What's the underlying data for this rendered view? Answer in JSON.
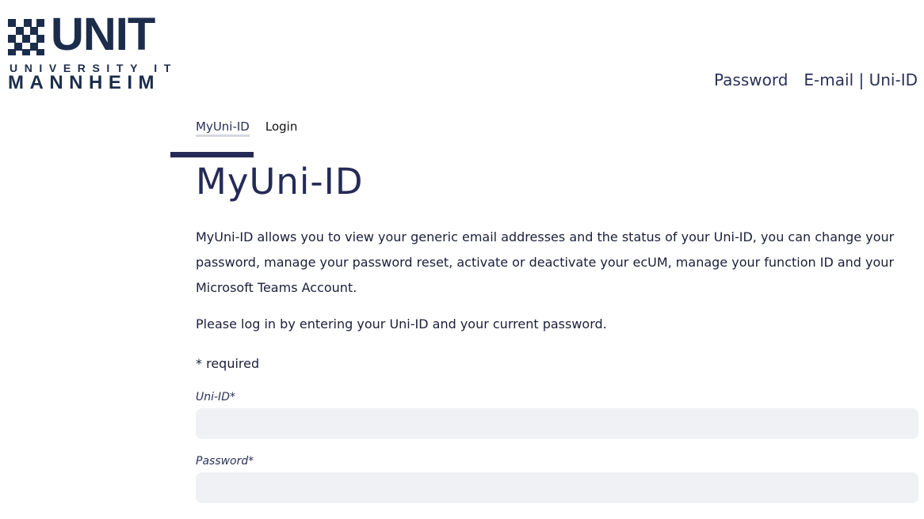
{
  "logo": {
    "word": "UNIT",
    "line1": "UNIVERSITY IT",
    "line2": "MANNHEIM"
  },
  "topnav": {
    "password": "Password",
    "email": "E-mail",
    "separator": "|",
    "uniid": "Uni-ID"
  },
  "breadcrumb": {
    "items": [
      "MyUni-ID",
      "Login"
    ]
  },
  "page": {
    "title": "MyUni-ID",
    "intro": "MyUni-ID allows you to view your generic email addresses and the status of your Uni-ID, you can change your password, manage your password reset, activate or deactivate your ecUM, manage your function ID and your Microsoft Teams Account.",
    "login_hint": "Please log in by entering your Uni-ID and your current password.",
    "required_note": "* required"
  },
  "form": {
    "uniid_label": "Uni-ID*",
    "uniid_value": "",
    "password_label": "Password*",
    "password_value": ""
  },
  "colors": {
    "brand": "#1c2d4c",
    "accent": "#252b56",
    "input_bg": "#f0f1f5"
  }
}
